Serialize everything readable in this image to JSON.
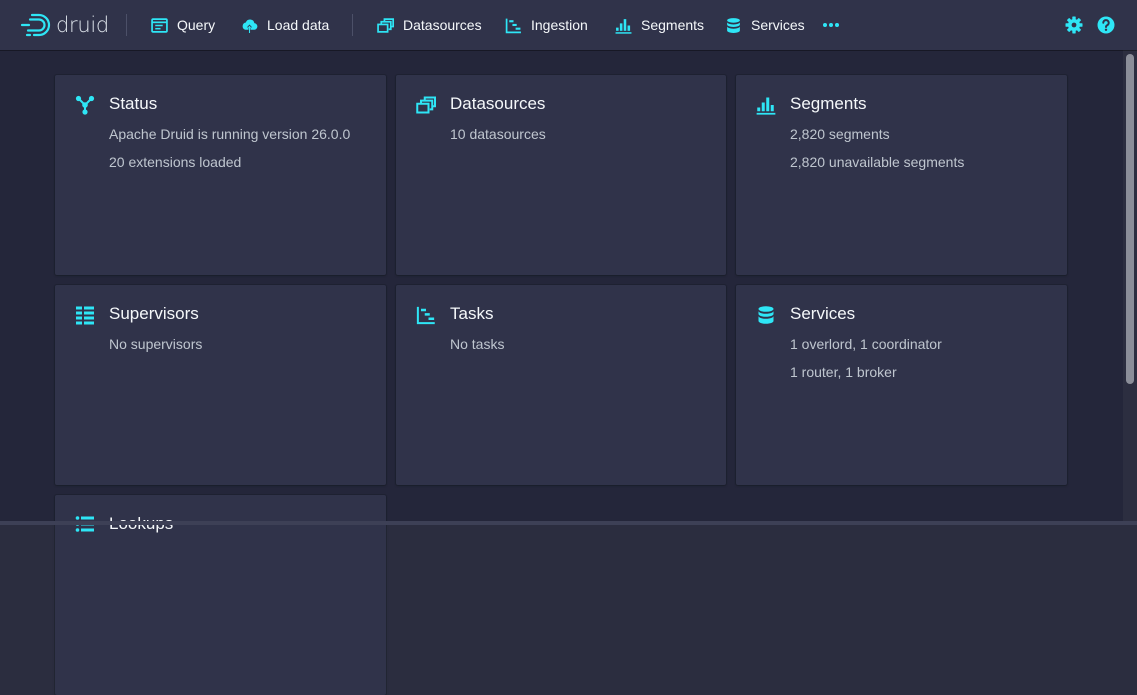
{
  "app": {
    "logo_text": "druid"
  },
  "nav": {
    "query": "Query",
    "load_data": "Load data",
    "datasources": "Datasources",
    "ingestion": "Ingestion",
    "segments": "Segments",
    "services": "Services"
  },
  "colors": {
    "accent": "#2ee6f6",
    "navbar_bg": "#30334a",
    "content_bg": "#24263a",
    "card_bg": "#30334a"
  },
  "cards": [
    {
      "icon": "cluster-nodes-icon",
      "title": "Status",
      "lines": [
        "Apache Druid is running version 26.0.0",
        "20 extensions loaded"
      ]
    },
    {
      "icon": "datasources-stack-icon",
      "title": "Datasources",
      "lines": [
        "10 datasources"
      ]
    },
    {
      "icon": "segments-bars-icon",
      "title": "Segments",
      "lines": [
        "2,820 segments",
        "2,820 unavailable segments"
      ]
    },
    {
      "icon": "supervisors-list-icon",
      "title": "Supervisors",
      "lines": [
        "No supervisors"
      ]
    },
    {
      "icon": "tasks-gantt-icon",
      "title": "Tasks",
      "lines": [
        "No tasks"
      ]
    },
    {
      "icon": "database-icon",
      "title": "Services",
      "lines": [
        "1 overlord, 1 coordinator",
        "1 router, 1 broker"
      ]
    },
    {
      "icon": "lookups-list-icon",
      "title": "Lookups",
      "lines": []
    }
  ]
}
